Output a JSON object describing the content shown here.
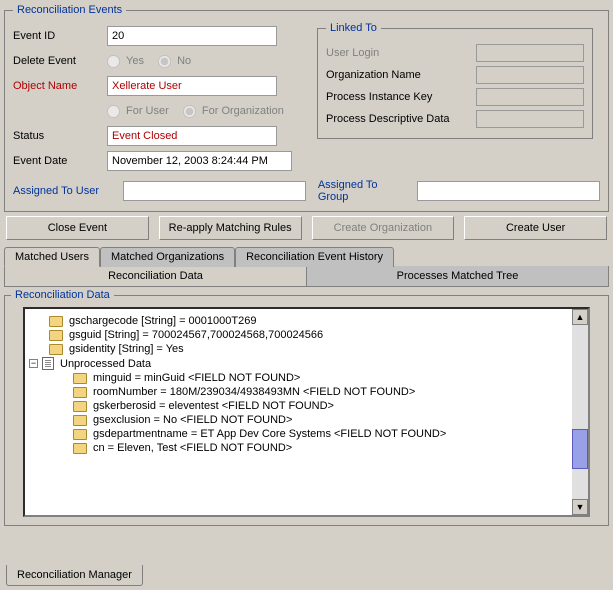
{
  "fieldsets": {
    "events_title": "Reconciliation Events",
    "linked_title": "Linked To",
    "recon_data_title": "Reconciliation Data"
  },
  "labels": {
    "event_id": "Event ID",
    "delete_event": "Delete Event",
    "object_name": "Object Name",
    "status": "Status",
    "event_date": "Event Date",
    "assigned_user": "Assigned To User",
    "assigned_group": "Assigned To Group"
  },
  "values": {
    "event_id": "20",
    "object_name": "Xellerate User",
    "status": "Event Closed",
    "event_date": "November 12, 2003 8:24:44 PM",
    "assigned_user": "",
    "assigned_group": ""
  },
  "radios": {
    "yes": "Yes",
    "no": "No",
    "for_user": "For User",
    "for_org": "For Organization"
  },
  "linked": {
    "user_login": "User Login",
    "org_name": "Organization Name",
    "proc_inst": "Process Instance Key",
    "proc_desc": "Process Descriptive Data"
  },
  "buttons": {
    "close_event": "Close Event",
    "reapply": "Re-apply Matching Rules",
    "create_org": "Create Organization",
    "create_user": "Create User"
  },
  "tabs": {
    "matched_users": "Matched Users",
    "matched_orgs": "Matched Organizations",
    "recon_history": "Reconciliation Event History"
  },
  "subtabs": {
    "recon_data": "Reconciliation Data",
    "proc_tree": "Processes Matched Tree"
  },
  "tree": {
    "items": [
      "gschargecode [String] = 0001000T269",
      "gsguid [String] = 700024567,700024568,700024566",
      "gsidentity [String] = Yes"
    ],
    "unprocessed_label": "Unprocessed Data",
    "unprocessed": [
      "minguid = minGuid <FIELD NOT FOUND>",
      "roomNumber = 180M/239034/4938493MN <FIELD NOT FOUND>",
      "gskerberosid = eleventest <FIELD NOT FOUND>",
      "gsexclusion = No <FIELD NOT FOUND>",
      "gsdepartmentname = ET App Dev Core Systems <FIELD NOT FOUND>",
      "cn = Eleven, Test <FIELD NOT FOUND>"
    ]
  },
  "bottom_tab": "Reconciliation Manager",
  "expander_minus": "−"
}
